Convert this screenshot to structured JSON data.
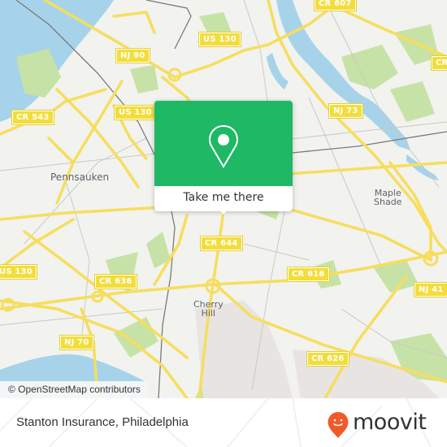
{
  "map": {
    "road_labels": [
      {
        "id": "cr-607",
        "text": "CR 607"
      },
      {
        "id": "us-130-north",
        "text": "US 130"
      },
      {
        "id": "nj-90",
        "text": "NJ 90"
      },
      {
        "id": "cr-543",
        "text": "CR 543"
      },
      {
        "id": "us-130-mid",
        "text": "US 130"
      },
      {
        "id": "nj-73",
        "text": "NJ 73"
      },
      {
        "id": "cr-east",
        "text": "CR"
      },
      {
        "id": "cr-644",
        "text": "CR 644"
      },
      {
        "id": "cr-616",
        "text": "CR 616"
      },
      {
        "id": "nj-41",
        "text": "NJ 41"
      },
      {
        "id": "us-130-west",
        "text": "US 130"
      },
      {
        "id": "cr-636",
        "text": "CR 636"
      },
      {
        "id": "nj-70",
        "text": "NJ 70"
      },
      {
        "id": "cr-626",
        "text": "CR 626"
      }
    ],
    "place_labels": [
      {
        "id": "pennsauken",
        "text": "Pennsauken"
      },
      {
        "id": "maple-shade",
        "text": "Maple\nShade"
      },
      {
        "id": "cherry-hill",
        "text": "Cherry\nHill"
      }
    ],
    "attribution": "© OpenStreetMap contributors",
    "colors": {
      "land": "#f2f2ef",
      "water": "#a6d3ea",
      "park": "#c7e2a6",
      "road": "#f6de5c",
      "minor_road": "#c9c9c4",
      "rail": "#7a7a7a"
    }
  },
  "popup": {
    "icon": "location-pin-icon",
    "button_label": "Take me there",
    "color": "#1fb865"
  },
  "footer": {
    "title": "Stanton Insurance, Philadelphia",
    "brand": "moovit",
    "brand_color": "#f05a28"
  }
}
